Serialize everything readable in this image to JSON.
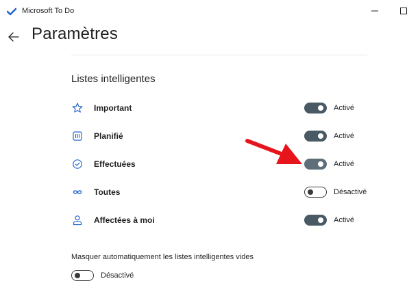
{
  "app": {
    "title": "Microsoft To Do"
  },
  "window_controls": {
    "minimize": "–",
    "maximize": "☐"
  },
  "header": {
    "title": "Paramètres"
  },
  "smart_lists": {
    "heading": "Listes intelligentes",
    "items": [
      {
        "label": "Important",
        "icon": "star-icon",
        "state": "on",
        "state_label": "Activé"
      },
      {
        "label": "Planifié",
        "icon": "calendar-icon",
        "state": "on",
        "state_label": "Activé"
      },
      {
        "label": "Effectuées",
        "icon": "check-circle-icon",
        "state": "on",
        "state_label": "Activé"
      },
      {
        "label": "Toutes",
        "icon": "infinity-icon",
        "state": "off",
        "state_label": "Désactivé"
      },
      {
        "label": "Affectées à moi",
        "icon": "person-icon",
        "state": "on",
        "state_label": "Activé"
      }
    ]
  },
  "auto_hide": {
    "label": "Masquer automatiquement les listes intelligentes vides",
    "state": "off",
    "state_label": "Désactivé"
  },
  "colors": {
    "toggle_on": "#4a5a65",
    "toggle_off_border": "#3a3a3a",
    "app_blue": "#2564cf",
    "annotation_arrow": "#e8141c"
  }
}
